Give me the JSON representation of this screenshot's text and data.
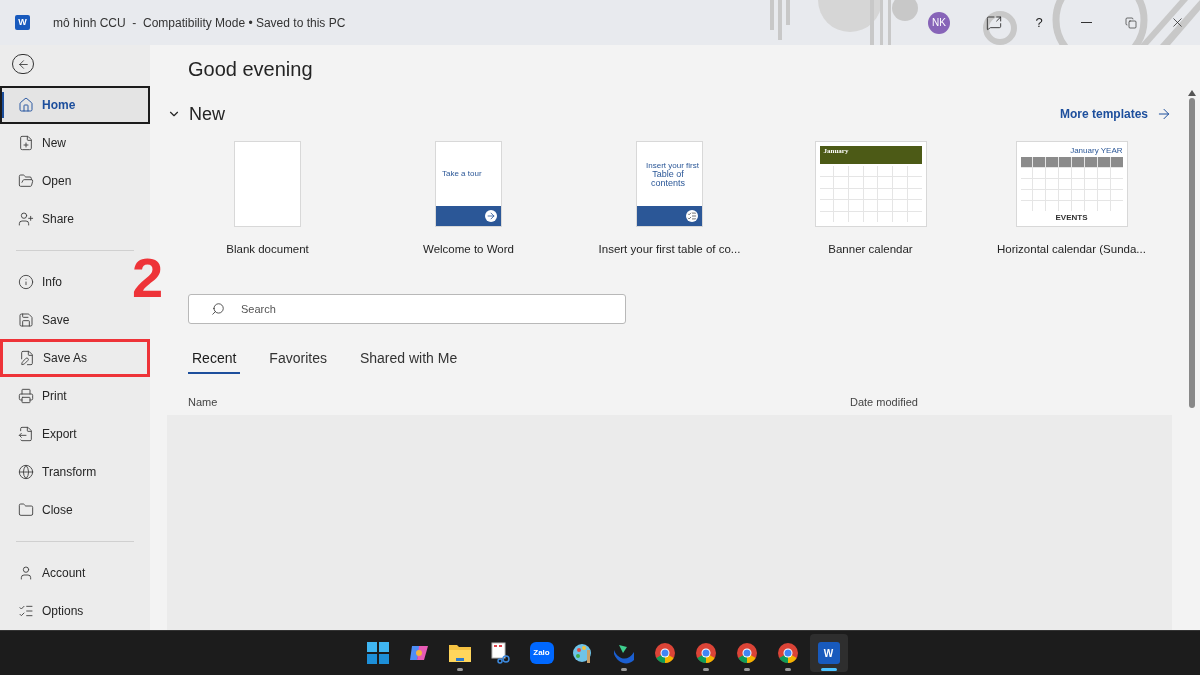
{
  "window": {
    "app_letter": "W",
    "title": "mô hình CCU  -  Compatibility Mode • Saved to this PC",
    "avatar": "NK",
    "help": "?"
  },
  "sidebar": {
    "groups": [
      [
        {
          "label": "Home",
          "selected": true,
          "highlighted": false
        },
        {
          "label": "New",
          "selected": false,
          "highlighted": false
        },
        {
          "label": "Open",
          "selected": false,
          "highlighted": false
        },
        {
          "label": "Share",
          "selected": false,
          "highlighted": false
        }
      ],
      [
        {
          "label": "Info",
          "selected": false,
          "highlighted": false
        },
        {
          "label": "Save",
          "selected": false,
          "highlighted": false
        },
        {
          "label": "Save As",
          "selected": false,
          "highlighted": true
        },
        {
          "label": "Print",
          "selected": false,
          "highlighted": false
        },
        {
          "label": "Export",
          "selected": false,
          "highlighted": false
        },
        {
          "label": "Transform",
          "selected": false,
          "highlighted": false
        },
        {
          "label": "Close",
          "selected": false,
          "highlighted": false
        }
      ],
      [
        {
          "label": "Account",
          "selected": false,
          "highlighted": false
        },
        {
          "label": "Options",
          "selected": false,
          "highlighted": false
        }
      ]
    ]
  },
  "annotation": {
    "step": "2"
  },
  "greeting": "Good evening",
  "new_section": {
    "title": "New",
    "expanded": true,
    "more_link": "More templates",
    "templates": [
      {
        "kind": "blank",
        "label": "Blank document"
      },
      {
        "kind": "tour",
        "label": "Welcome to Word",
        "thumb_text": [
          "Take a tour"
        ]
      },
      {
        "kind": "toc",
        "label": "Insert your first table of co...",
        "thumb_text": [
          "Insert your first",
          "Table of contents"
        ]
      },
      {
        "kind": "banner",
        "label": "Banner calendar",
        "thumb_text": [
          "January"
        ]
      },
      {
        "kind": "horizontal",
        "label": "Horizontal calendar (Sunda...",
        "thumb_text": [
          "January YEAR",
          "EVENTS"
        ]
      }
    ]
  },
  "search": {
    "placeholder": "Search"
  },
  "tabs": [
    {
      "label": "Recent",
      "selected": true
    },
    {
      "label": "Favorites",
      "selected": false
    },
    {
      "label": "Shared with Me",
      "selected": false
    }
  ],
  "table": {
    "columns": [
      "Name",
      "Date modified"
    ]
  },
  "taskbar": [
    {
      "kind": "start",
      "running": false,
      "active": false
    },
    {
      "kind": "copilot",
      "running": false,
      "active": false
    },
    {
      "kind": "folder",
      "running": true,
      "active": false
    },
    {
      "kind": "snip",
      "running": false,
      "active": false
    },
    {
      "kind": "chat",
      "label": "Zalo",
      "running": false,
      "active": false
    },
    {
      "kind": "paint",
      "running": false,
      "active": false
    },
    {
      "kind": "wave",
      "running": true,
      "active": false
    },
    {
      "kind": "browser",
      "running": false,
      "active": false
    },
    {
      "kind": "browser",
      "running": true,
      "active": false
    },
    {
      "kind": "browser",
      "running": true,
      "active": false
    },
    {
      "kind": "browser",
      "running": true,
      "active": false
    },
    {
      "kind": "word",
      "label": "W",
      "running": true,
      "active": true
    }
  ]
}
